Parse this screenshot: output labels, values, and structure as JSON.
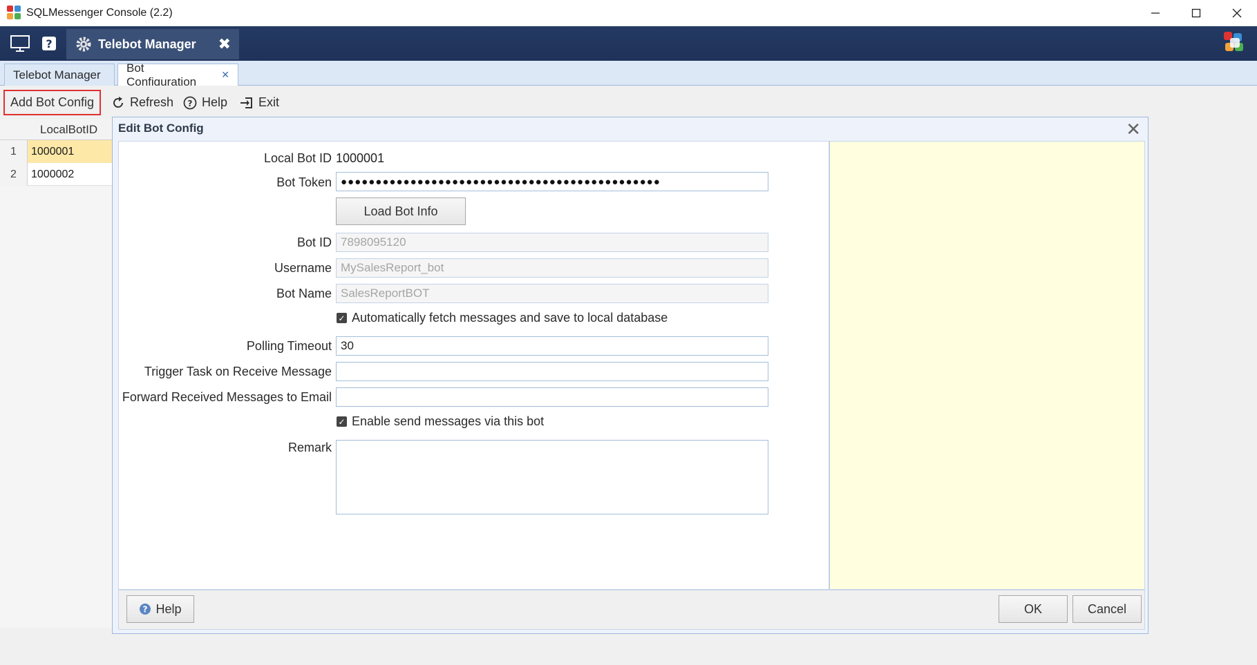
{
  "window": {
    "title": "SQLMessenger Console (2.2)"
  },
  "header": {
    "active_tab": "Telebot Manager"
  },
  "doc_tabs": [
    {
      "label": "Telebot Manager"
    },
    {
      "label": "Bot Configuration"
    }
  ],
  "toolbar": {
    "add_label": "Add Bot Config",
    "refresh_label": "Refresh",
    "help_label": "Help",
    "exit_label": "Exit"
  },
  "grid": {
    "column": "LocalBotID",
    "rows": [
      {
        "num": "1",
        "value": "1000001"
      },
      {
        "num": "2",
        "value": "1000002"
      }
    ]
  },
  "dialog": {
    "title": "Edit Bot Config",
    "local_bot_id_label": "Local Bot ID",
    "local_bot_id_value": "1000001",
    "bot_token_label": "Bot Token",
    "bot_token_value": "●●●●●●●●●●●●●●●●●●●●●●●●●●●●●●●●●●●●●●●●●●●●●●",
    "load_bot_info_label": "Load Bot Info",
    "bot_id_label": "Bot ID",
    "bot_id_value": "7898095120",
    "username_label": "Username",
    "username_value": "MySalesReport_bot",
    "bot_name_label": "Bot Name",
    "bot_name_value": "SalesReportBOT",
    "auto_fetch_label": "Automatically fetch messages and save to local database",
    "polling_timeout_label": "Polling Timeout",
    "polling_timeout_value": "30",
    "trigger_task_label": "Trigger Task on Receive Message",
    "trigger_task_value": "",
    "forward_email_label": "Forward Received Messages to Email",
    "forward_email_value": "",
    "enable_send_label": "Enable send messages via this bot",
    "remark_label": "Remark",
    "help_label": "Help",
    "ok_label": "OK",
    "cancel_label": "Cancel"
  },
  "colors": {
    "header_bg": "#1f3259",
    "accent_blue": "#9db8dc",
    "side_panel": "#ffffe0",
    "selected_row": "#fde8a8",
    "highlight_border": "#e03030"
  }
}
